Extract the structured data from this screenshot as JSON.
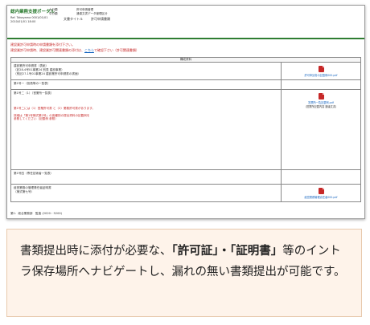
{
  "screenshot": {
    "header": {
      "logo": "総内業務支援ポータル",
      "org_label": "大分類",
      "org_sub": "中分類",
      "sys_line1": "許可申請管理",
      "sys_line2": "通達文書データ管理区分",
      "user_line1": "Ref. Takayama 0001/01/01",
      "user_line2": "2010/01/01 18:00",
      "page_label": "文書タイトル",
      "page_title": "許可申請書類"
    },
    "messages": {
      "line1": "建設業許可申請時の申請書類を添付下さい。",
      "line2_prefix": "建設業許可申請時、建設業許可関連書類の添付は、",
      "line2_link": "こちら",
      "line2_suffix": "で確認下さい（許可関連書類）"
    },
    "table": {
      "col_header": "構成資料",
      "rows": [
        {
          "label": "建設業許可申請書（表紙）",
          "sub1": "（記28-4号01事業24 別表 建設事業）",
          "sub2": "（別記27-1号01事業24 建設業許可申請書の書面）",
          "file_name": "許可申請書の記載例000.pdf",
          "note": ""
        },
        {
          "label": "第1号一（役員等の一覧表）",
          "sub1": "",
          "sub2": "",
          "file_name": "",
          "note": ""
        },
        {
          "label": "第1号二（1）（営業所一覧表）",
          "sub1": "",
          "sub2": "",
          "file_name": "営業所一覧記載例.pdf",
          "note": "（営業所記載内容 通達文書）"
        },
        {
          "label": "第1号四（専任技術者一覧表）",
          "sub1": "",
          "sub2": "",
          "file_name": "",
          "note": ""
        },
        {
          "label": "経営業務の管理責任者証明書",
          "sub1": "（様式第七号）",
          "sub2": "",
          "file_name": "経営業務管理責任者000.pdf",
          "note": ""
        }
      ],
      "row3_red1": "第1号二には（1）営業許可書 と（2）業務許可書があります。",
      "row3_red2": "詳細は「第1号様式第2号」の各種別の提出資料の記載例を",
      "row3_red3": "参照してください（記載例 参照）"
    },
    "footer": "第1：総合業務部　監査 (2020・5200)"
  },
  "caption": {
    "part1": "書類提出時に添付が必要な、",
    "bold1": "「許可証」・「証明書」",
    "part2": "等のイントラ保存場所へナビゲートし、漏れの無い書類提出が可能です。"
  },
  "colors": {
    "accent": "#2e7d32",
    "alert": "#c62828",
    "link": "#1565c0",
    "caption_bg": "#fef3ea"
  }
}
